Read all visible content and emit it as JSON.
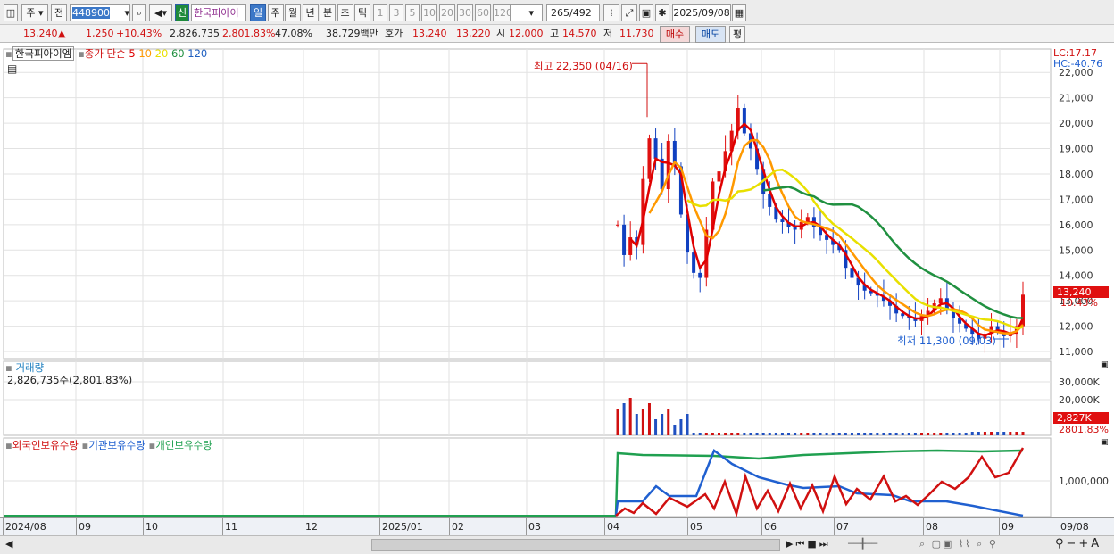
{
  "toolbar": {
    "market": "주",
    "prev": "전",
    "code": "448900",
    "new_badge": "신",
    "name": "한국피아이",
    "periods": [
      "일",
      "주",
      "월",
      "년",
      "분",
      "초",
      "틱"
    ],
    "active_period": "일",
    "minutes": [
      "1",
      "3",
      "5",
      "10",
      "20",
      "30",
      "60",
      "120"
    ],
    "count_shown": "265",
    "count_total": "/492",
    "date": "2025/09/08"
  },
  "quote": {
    "price": "13,240",
    "change": "1,250",
    "change_pct": "+10.43%",
    "volume": "2,826,735",
    "vol_pct": "2,801.83%",
    "ratio": "47.08%",
    "amount": "38,729백만",
    "hoga_label": "호가",
    "ask": "13,240",
    "bid": "13,220",
    "open_label": "시",
    "open": "12,000",
    "high_label": "고",
    "high": "14,570",
    "low_label": "저",
    "low": "11,730",
    "buy": "매수",
    "sell": "매도",
    "eval": "평"
  },
  "price_panel": {
    "title": "한국피아이엠",
    "ma_label": "종가 단순",
    "ma_periods": [
      "5",
      "10",
      "20",
      "60",
      "120"
    ],
    "ma_colors": [
      "#e00000",
      "#ff9900",
      "#e8e000",
      "#209040",
      "#2060c0"
    ],
    "lc": "LC:17.17",
    "hc": "HC:-40.76",
    "high_annot": "최고 22,350 (04/16)",
    "low_annot": "최저 11,300 (09/03)",
    "cur_price": "13,240",
    "cur_pct": "10.43%",
    "yticks": [
      "22,000",
      "21,000",
      "20,000",
      "19,000",
      "18,000",
      "17,000",
      "16,000",
      "15,000",
      "14,000",
      "13,000",
      "12,000",
      "11,000"
    ]
  },
  "volume_panel": {
    "title": "거래량",
    "value": "2,826,735주(2,801.83%)",
    "yticks": [
      "30,000K",
      "20,000K"
    ],
    "cur": "2,827K",
    "cur_pct": "2801.83%"
  },
  "hold_panel": {
    "legends": [
      {
        "label": "외국인보유수량",
        "color": "#d01010"
      },
      {
        "label": "기관보유수량",
        "color": "#2060d0"
      },
      {
        "label": "개인보유수량",
        "color": "#20a050"
      }
    ],
    "ytick": "1,000,000"
  },
  "xaxis": [
    "2024/08",
    "09",
    "10",
    "11",
    "12",
    "2025/01",
    "02",
    "03",
    "04",
    "05",
    "06",
    "07",
    "08",
    "09",
    "09/08"
  ],
  "chart_data": {
    "type": "candlestick",
    "y_range": [
      11000,
      22500
    ],
    "close_series": [
      16000,
      14800,
      15500,
      15200,
      17800,
      19400,
      18600,
      17400,
      19300,
      18300,
      16400,
      14900,
      14100,
      13900,
      15800,
      17700,
      18100,
      18900,
      19700,
      20600,
      19600,
      19000,
      18200,
      17200,
      16700,
      16200,
      16100,
      15900,
      15800,
      16100,
      16300,
      15900,
      15600,
      15400,
      15200,
      15000,
      14300,
      13900,
      13600,
      13400,
      13300,
      13200,
      13000,
      12800,
      12500,
      12400,
      12300,
      12200,
      12400,
      12600,
      12900,
      13100,
      12700,
      12300,
      12100,
      11900,
      11700,
      11500,
      11700,
      12000,
      11800,
      11600,
      11700,
      12000,
      13240
    ]
  }
}
